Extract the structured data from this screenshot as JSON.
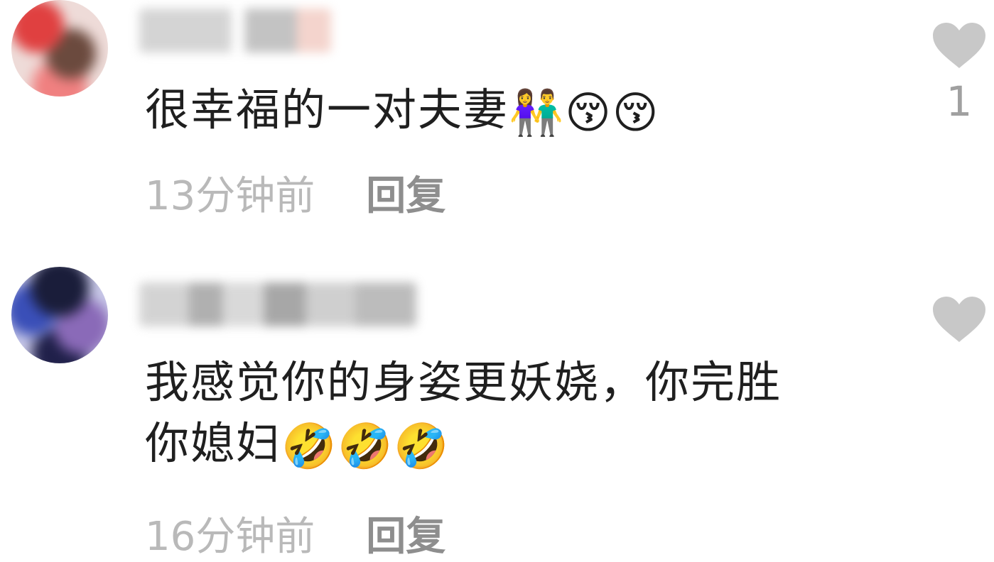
{
  "comments": [
    {
      "text": "很幸福的一对夫妻",
      "emojis": [
        "👫",
        "😚",
        "😚"
      ],
      "time": "13分钟前",
      "reply_label": "回复",
      "like_count": "1"
    },
    {
      "text_line1": "我感觉你的身姿更妖娆，你完胜",
      "text_line2": "你媳妇",
      "emojis": [
        "🤣",
        "🤣",
        "🤣"
      ],
      "time": "16分钟前",
      "reply_label": "回复",
      "like_count": ""
    }
  ],
  "colors": {
    "text": "#1f1f1f",
    "time": "#b9b9b9",
    "reply": "#8e8e8e",
    "heart": "#c8c8c8",
    "like_count": "#a0a0a0"
  }
}
